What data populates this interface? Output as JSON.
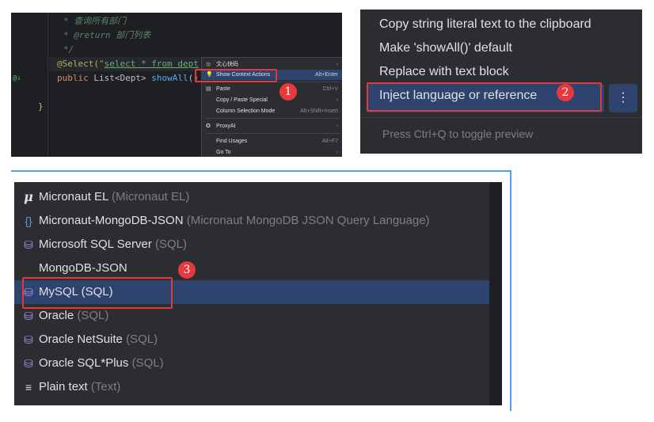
{
  "editor": {
    "lines": [
      {
        "text": "* 查询所有部门",
        "cls": "c-comment"
      },
      {
        "text": "* @return 部门列表",
        "cls": "c-comment"
      },
      {
        "text": "*/",
        "cls": "c-comment"
      },
      {
        "text": "@Select(\"select * from dept",
        "cls": "c-ann"
      },
      {
        "text": "public List<Dept> showAll()",
        "cls": "c-def"
      },
      {
        "text": "",
        "cls": "c-def"
      },
      {
        "text": "}",
        "cls": "c-brace"
      }
    ],
    "gutter_marker": "@↓"
  },
  "context_menu": {
    "items": [
      {
        "label": "文心快码",
        "shortcut": "›",
        "icon": "ai-icon"
      },
      {
        "label": "Show Context Actions",
        "shortcut": "Alt+Enter",
        "icon": "bulb-icon",
        "selected": true
      },
      {
        "label": "Paste",
        "shortcut": "Ctrl+V",
        "icon": "paste-icon"
      },
      {
        "label": "Copy / Paste Special",
        "shortcut": "›"
      },
      {
        "label": "Column Selection Mode",
        "shortcut": "Alt+Shift+Insert"
      },
      {
        "label": "ProxyAI",
        "shortcut": "›",
        "icon": "proxyai-icon"
      },
      {
        "label": "Find Usages",
        "shortcut": "Alt+F7"
      },
      {
        "label": "Go To",
        "shortcut": "›"
      }
    ]
  },
  "intention_menu": {
    "items": [
      {
        "label": "Copy string literal text to the clipboard"
      },
      {
        "label": "Make 'showAll()' default"
      },
      {
        "label": "Replace with text block"
      },
      {
        "label": "Inject language or reference",
        "selected": true
      }
    ],
    "more_icon": "⋮",
    "footer": "Press Ctrl+Q to toggle preview"
  },
  "language_list": {
    "items": [
      {
        "name": "Micronaut EL",
        "hint": "(Micronaut EL)",
        "icon": "mu-icon"
      },
      {
        "name": "Micronaut-MongoDB-JSON",
        "hint": "(Micronaut MongoDB JSON Query Language)",
        "icon": "json-icon"
      },
      {
        "name": "Microsoft SQL Server",
        "hint": "(SQL)",
        "icon": "database-icon"
      },
      {
        "name": "MongoDB-JSON",
        "hint": "",
        "icon": ""
      },
      {
        "name": "MySQL (SQL)",
        "hint": "",
        "icon": "database-icon",
        "selected": true
      },
      {
        "name": "Oracle",
        "hint": "(SQL)",
        "icon": "database-icon"
      },
      {
        "name": "Oracle NetSuite",
        "hint": "(SQL)",
        "icon": "database-icon"
      },
      {
        "name": "Oracle SQL*Plus",
        "hint": "(SQL)",
        "icon": "database-icon"
      },
      {
        "name": "Plain text",
        "hint": "(Text)",
        "icon": "text-icon"
      }
    ]
  },
  "badges": [
    "1",
    "2",
    "3"
  ],
  "colors": {
    "accent": "#e03a3e",
    "selection": "#2e436e",
    "frame": "#4ea0ea"
  }
}
